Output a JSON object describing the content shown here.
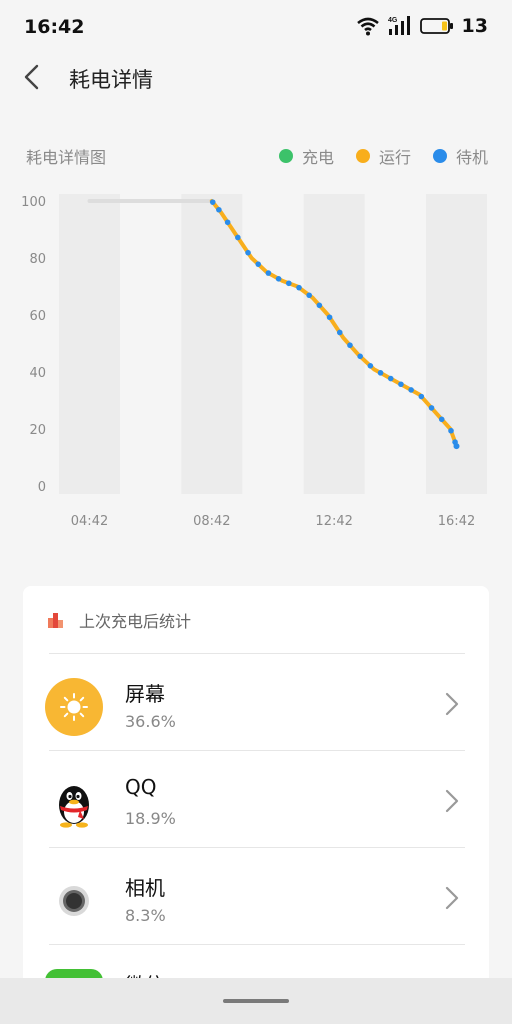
{
  "status_bar": {
    "time": "16:42",
    "network_label": "4G",
    "battery_level": "13"
  },
  "header": {
    "title": "耗电详情"
  },
  "chart_section": {
    "title": "耗电详情图",
    "legend": [
      {
        "label": "充电",
        "color": "#3cc26a"
      },
      {
        "label": "运行",
        "color": "#f8ae1c"
      },
      {
        "label": "待机",
        "color": "#2a8cea"
      }
    ]
  },
  "chart_data": {
    "type": "line",
    "y_ticks": [
      "100",
      "80",
      "60",
      "40",
      "20",
      "0"
    ],
    "x_ticks": [
      "04:42",
      "08:42",
      "12:42",
      "16:42"
    ],
    "ylim": [
      0,
      100
    ],
    "x": [
      "04:42",
      "05:42",
      "06:42",
      "07:42",
      "08:42",
      "09:00",
      "09:30",
      "10:00",
      "10:30",
      "11:00",
      "11:30",
      "12:00",
      "12:30",
      "13:00",
      "13:30",
      "14:00",
      "14:30",
      "15:00",
      "15:30",
      "16:00",
      "16:30",
      "16:42"
    ],
    "series": [
      {
        "values": [
          100,
          100,
          100,
          100,
          100,
          96,
          88,
          80,
          75,
          72,
          70,
          66,
          60,
          52,
          46,
          41,
          38,
          35,
          32,
          26,
          20,
          14
        ]
      }
    ],
    "colors": {
      "running": "#f8ae1c",
      "standby": "#2a8cea",
      "no_data": "#dddddd",
      "band": "#ececec"
    }
  },
  "stats_card": {
    "title": "上次充电后统计",
    "items": [
      {
        "name": "屏幕",
        "percent": "36.6%",
        "icon": "sun-icon"
      },
      {
        "name": "QQ",
        "percent": "18.9%",
        "icon": "qq-penguin-icon"
      },
      {
        "name": "相机",
        "percent": "8.3%",
        "icon": "camera-icon"
      },
      {
        "name": "微信",
        "percent": "",
        "icon": "wechat-icon"
      }
    ]
  }
}
